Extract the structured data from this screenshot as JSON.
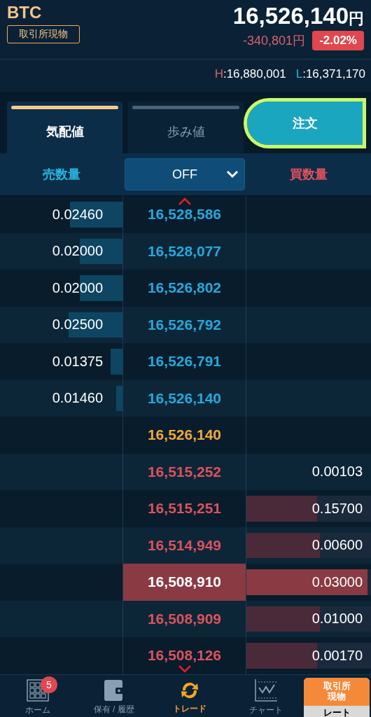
{
  "header": {
    "symbol": "BTC",
    "market_badge": "取引所現物",
    "price": "16,526,140",
    "price_unit": "円",
    "change": "-340,801",
    "change_unit": "円",
    "change_pct": "-2.02%",
    "high_label": "H",
    "high": ":16,880,001",
    "low_label": "L",
    "low": ":16,371,170"
  },
  "tabs": [
    {
      "label": "気配値",
      "selected": true
    },
    {
      "label": "歩み値",
      "selected": false
    }
  ],
  "order_button": {
    "label": "注文",
    "highlighted": true
  },
  "columns": {
    "sell": "売数量",
    "filter": "OFF",
    "buy": "買数量"
  },
  "rows": [
    {
      "kind": "ask",
      "price": "16,528,586",
      "qty": "0.02460",
      "level": 0.43,
      "selected": false
    },
    {
      "kind": "ask",
      "price": "16,528,077",
      "qty": "0.02000",
      "level": 0.35,
      "selected": false
    },
    {
      "kind": "ask",
      "price": "16,526,802",
      "qty": "0.02000",
      "level": 0.35,
      "selected": false
    },
    {
      "kind": "ask",
      "price": "16,526,792",
      "qty": "0.02500",
      "level": 0.44,
      "selected": false
    },
    {
      "kind": "ask",
      "price": "16,526,791",
      "qty": "0.01375",
      "level": 0.1,
      "selected": false
    },
    {
      "kind": "ask",
      "price": "16,526,140",
      "qty": "0.01460",
      "level": 0.05,
      "selected": false
    },
    {
      "kind": "last",
      "price": "16,526,140",
      "selected": false
    },
    {
      "kind": "bid",
      "price": "16,515,252",
      "qty": "0.00103",
      "selected": false
    },
    {
      "kind": "bid",
      "price": "16,515,251",
      "qty": "0.15700",
      "level": 0.57,
      "selected": false
    },
    {
      "kind": "bid",
      "price": "16,514,949",
      "qty": "0.00600",
      "level": 0.59,
      "selected": false
    },
    {
      "kind": "bid",
      "price": "16,508,910",
      "qty": "0.03000",
      "level": 0.97,
      "selected": true
    },
    {
      "kind": "bid",
      "price": "16,508,909",
      "qty": "0.01000",
      "level": 0.59,
      "selected": false
    },
    {
      "kind": "bid",
      "price": "16,508,126",
      "qty": "0.00170",
      "level": 0.57,
      "selected": false
    }
  ],
  "nav": [
    {
      "kind": "grid",
      "label": "ホーム",
      "badge": "5",
      "selected": false
    },
    {
      "kind": "wallet",
      "label": "保有 / 履歴",
      "selected": false
    },
    {
      "kind": "trade",
      "label": "トレード",
      "selected": true
    },
    {
      "kind": "chart",
      "label": "チャート",
      "selected": false
    }
  ],
  "rate_button": {
    "top": "取引所現物",
    "bottom": "レート"
  }
}
